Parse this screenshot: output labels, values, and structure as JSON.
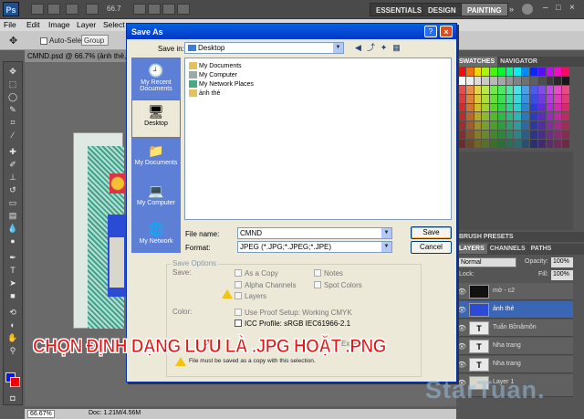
{
  "app": {
    "logo": "Ps",
    "zoom": "66.7",
    "workspaces": [
      "ESSENTIALS",
      "DESIGN",
      "PAINTING"
    ]
  },
  "menu": [
    "File",
    "Edit",
    "Image",
    "Layer",
    "Select",
    "Filter",
    "Analysis",
    "3D",
    "View",
    "Window",
    "Help"
  ],
  "options": {
    "auto_select": "Auto-Select:",
    "group": "Group"
  },
  "document": {
    "tab": "CMND.psd @ 66.7% (ảnh thẻ, RGB/8) *",
    "status_zoom": "66.67%",
    "status_doc": "Doc: 1.21M/4.56M"
  },
  "panels": {
    "swatches_tab": "SWATCHES",
    "navigator_tab": "NAVIGATOR",
    "brush_presets": "BRUSH PRESETS",
    "layers_tab": "LAYERS",
    "channels_tab": "CHANNELS",
    "paths_tab": "PATHS",
    "blend_mode": "Normal",
    "opacity_label": "Opacity:",
    "opacity": "100%",
    "lock_label": "Lock:",
    "fill_label": "Fill:",
    "fill": "100%",
    "layers": [
      "mờ - c2",
      "ảnh thẻ",
      "Tuấn Bồnâmôn",
      "Nha trang",
      "Nha trang",
      "Layer 1"
    ]
  },
  "dialog": {
    "title": "Save As",
    "save_in_label": "Save in:",
    "save_in_value": "Desktop",
    "places": [
      "My Recent Documents",
      "Desktop",
      "My Documents",
      "My Computer",
      "My Network"
    ],
    "files": [
      "My Documents",
      "My Computer",
      "My Network Places",
      "ảnh thẻ"
    ],
    "file_name_label": "File name:",
    "file_name_value": "CMND",
    "format_label": "Format:",
    "format_value": "JPEG (*.JPG;*.JPEG;*.JPE)",
    "save_button": "Save",
    "cancel_button": "Cancel",
    "save_options_title": "Save Options",
    "save_label": "Save:",
    "as_copy": "As a Copy",
    "notes": "Notes",
    "alpha_channels": "Alpha Channels",
    "spot_colors": "Spot Colors",
    "layers": "Layers",
    "color_label": "Color:",
    "use_proof": "Use Proof Setup:  Working CMYK",
    "icc_profile": "ICC Profile:  sRGB IEC61966-2.1",
    "extension": "Extens",
    "warning": "File must be saved as a copy with this selection."
  },
  "overlay": {
    "caption": "CHỌN ĐỊNH DẠNG LƯU LÀ .JPG HOẶT .PNG",
    "watermark": "StarTuan."
  }
}
